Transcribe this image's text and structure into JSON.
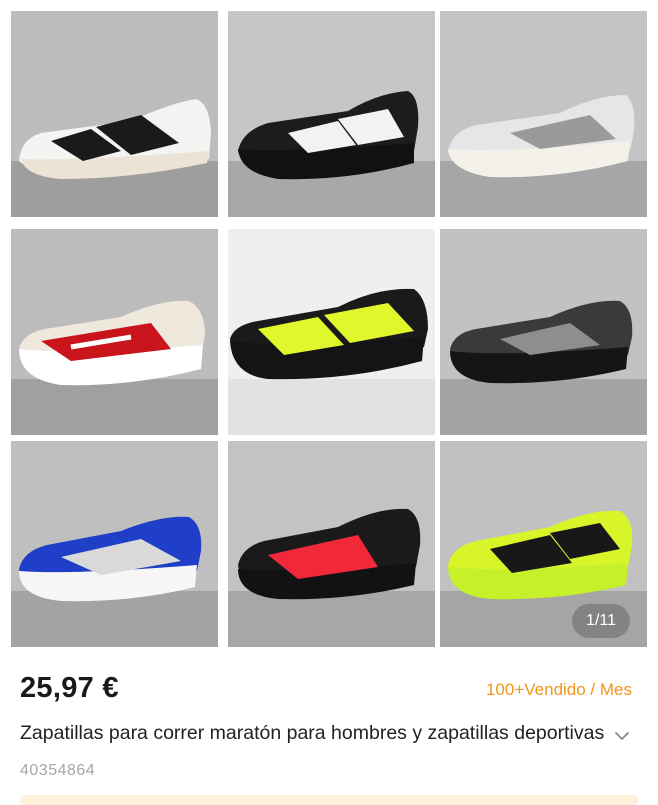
{
  "gallery": {
    "counter": "1/11",
    "thumbnails": [
      {
        "icon": "white-black-stripe-sneaker-photo"
      },
      {
        "icon": "black-white-stripe-sneaker-photo"
      },
      {
        "icon": "grey-white-sneaker-photo"
      },
      {
        "icon": "white-red-sneaker-photo"
      },
      {
        "icon": "black-neon-yellow-sneaker-photo"
      },
      {
        "icon": "black-grey-sneaker-photo"
      },
      {
        "icon": "blue-white-sneaker-photo"
      },
      {
        "icon": "black-red-sneaker-photo"
      },
      {
        "icon": "neon-yellow-black-sneaker-photo"
      }
    ]
  },
  "product": {
    "price": "25,97 €",
    "sold": "100+Vendido / Mes",
    "title": "Zapatillas para correr maratón para hombres y zapatillas deportivas",
    "sku": "40354864"
  },
  "colors": {
    "accent": "#f0961a",
    "sku_text": "#a6a6a6"
  }
}
